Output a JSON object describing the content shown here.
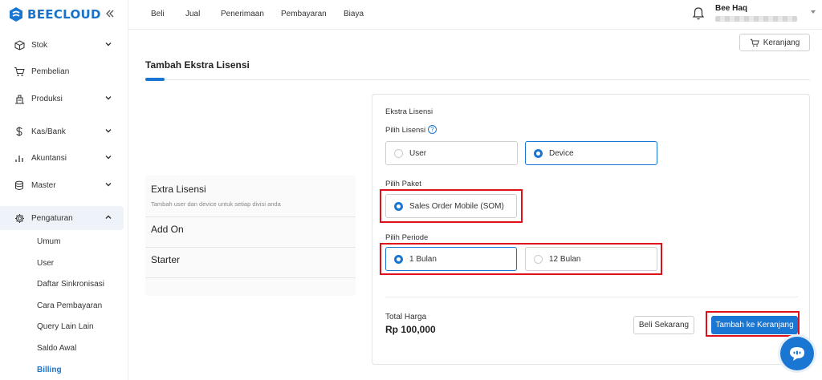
{
  "brand": {
    "name": "BEECLOUD",
    "accent": "#1976d2"
  },
  "sidebar": {
    "items": [
      {
        "label": "Stok",
        "icon": "box-icon",
        "has_chevron": true
      },
      {
        "label": "Pembelian",
        "icon": "cart-icon",
        "has_chevron": false
      },
      {
        "label": "Produksi",
        "icon": "factory-icon",
        "has_chevron": true
      },
      {
        "label": "Kas/Bank",
        "icon": "dollar-icon",
        "has_chevron": true
      },
      {
        "label": "Akuntansi",
        "icon": "bar-chart-icon",
        "has_chevron": true
      },
      {
        "label": "Master",
        "icon": "database-icon",
        "has_chevron": true
      },
      {
        "label": "Pengaturan",
        "icon": "gear-icon",
        "has_chevron": true,
        "expanded": true
      }
    ],
    "subitems": [
      "Umum",
      "User",
      "Daftar Sinkronisasi",
      "Cara Pembayaran",
      "Query Lain Lain",
      "Saldo Awal",
      "Billing"
    ],
    "active_subitem": "Billing"
  },
  "topnav": [
    "Beli",
    "Jual",
    "Penerimaan",
    "Pembayaran",
    "Biaya"
  ],
  "user": {
    "name": "Bee Haq"
  },
  "cart_button": "Keranjang",
  "page_title": "Tambah Ekstra Lisensi",
  "products": [
    {
      "title": "Extra Lisensi",
      "desc": "Tambah user dan device untuk setiap divisi anda"
    },
    {
      "title": "Add On",
      "desc": ""
    },
    {
      "title": "Starter",
      "desc": ""
    }
  ],
  "panel": {
    "heading": "Ekstra Lisensi",
    "license_label": "Pilih Lisensi",
    "license_help": "?",
    "license_options": [
      {
        "label": "User",
        "selected": false
      },
      {
        "label": "Device",
        "selected": true
      }
    ],
    "package_label": "Pilih Paket",
    "package_options": [
      {
        "label": "Sales Order Mobile (SOM)",
        "selected": true
      }
    ],
    "period_label": "Pilih Periode",
    "period_options": [
      {
        "label": "1 Bulan",
        "selected": true
      },
      {
        "label": "12 Bulan",
        "selected": false
      }
    ],
    "total_label": "Total Harga",
    "total_value": "Rp 100,000",
    "buy_now": "Beli Sekarang",
    "add_to_cart": "Tambah ke Keranjang"
  },
  "highlight_color": "#e0101a"
}
